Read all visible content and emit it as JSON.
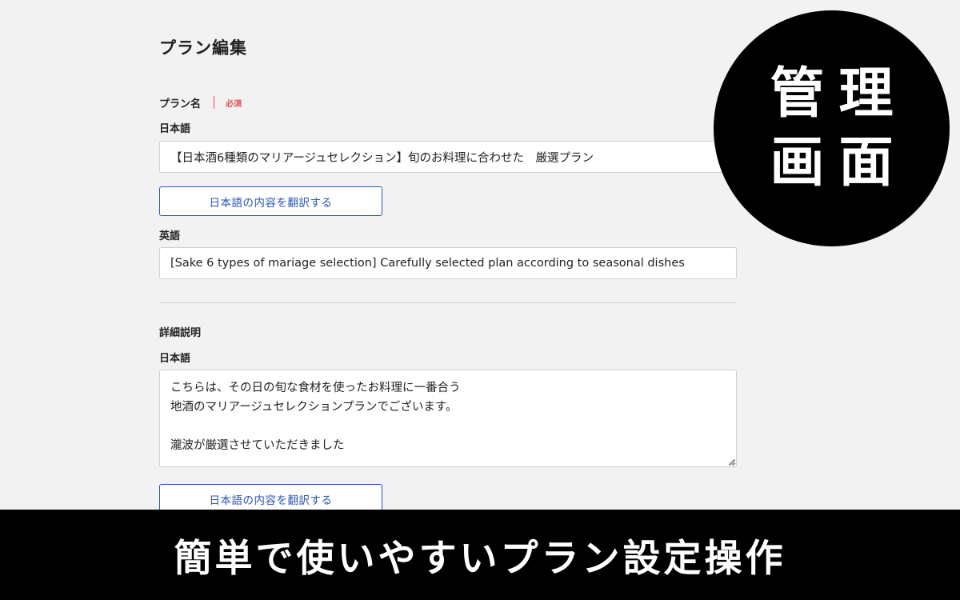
{
  "page": {
    "title": "プラン編集"
  },
  "plan_name": {
    "label": "プラン名",
    "required": "必須",
    "japanese_label": "日本語",
    "japanese_value": "【日本酒6種類のマリアージュセレクション】旬のお料理に合わせた　厳選プラン",
    "translate_button": "日本語の内容を翻訳する",
    "english_label": "英語",
    "english_value": "[Sake 6 types of mariage selection] Carefully selected plan according to seasonal dishes"
  },
  "description": {
    "label": "詳細説明",
    "japanese_label": "日本語",
    "japanese_value": "こちらは、その日の旬な食材を使ったお料理に一番合う\n地酒のマリアージュセレクションプランでございます。\n\n瀧波が厳選させていただきました",
    "translate_button": "日本語の内容を翻訳する"
  },
  "overlay": {
    "circle_line1": "管理",
    "circle_line2": "画面",
    "banner_text": "簡単で使いやすいプラン設定操作"
  },
  "colors": {
    "accent": "#2a55b8",
    "required": "#e0524f",
    "background": "#f2f2f2"
  }
}
